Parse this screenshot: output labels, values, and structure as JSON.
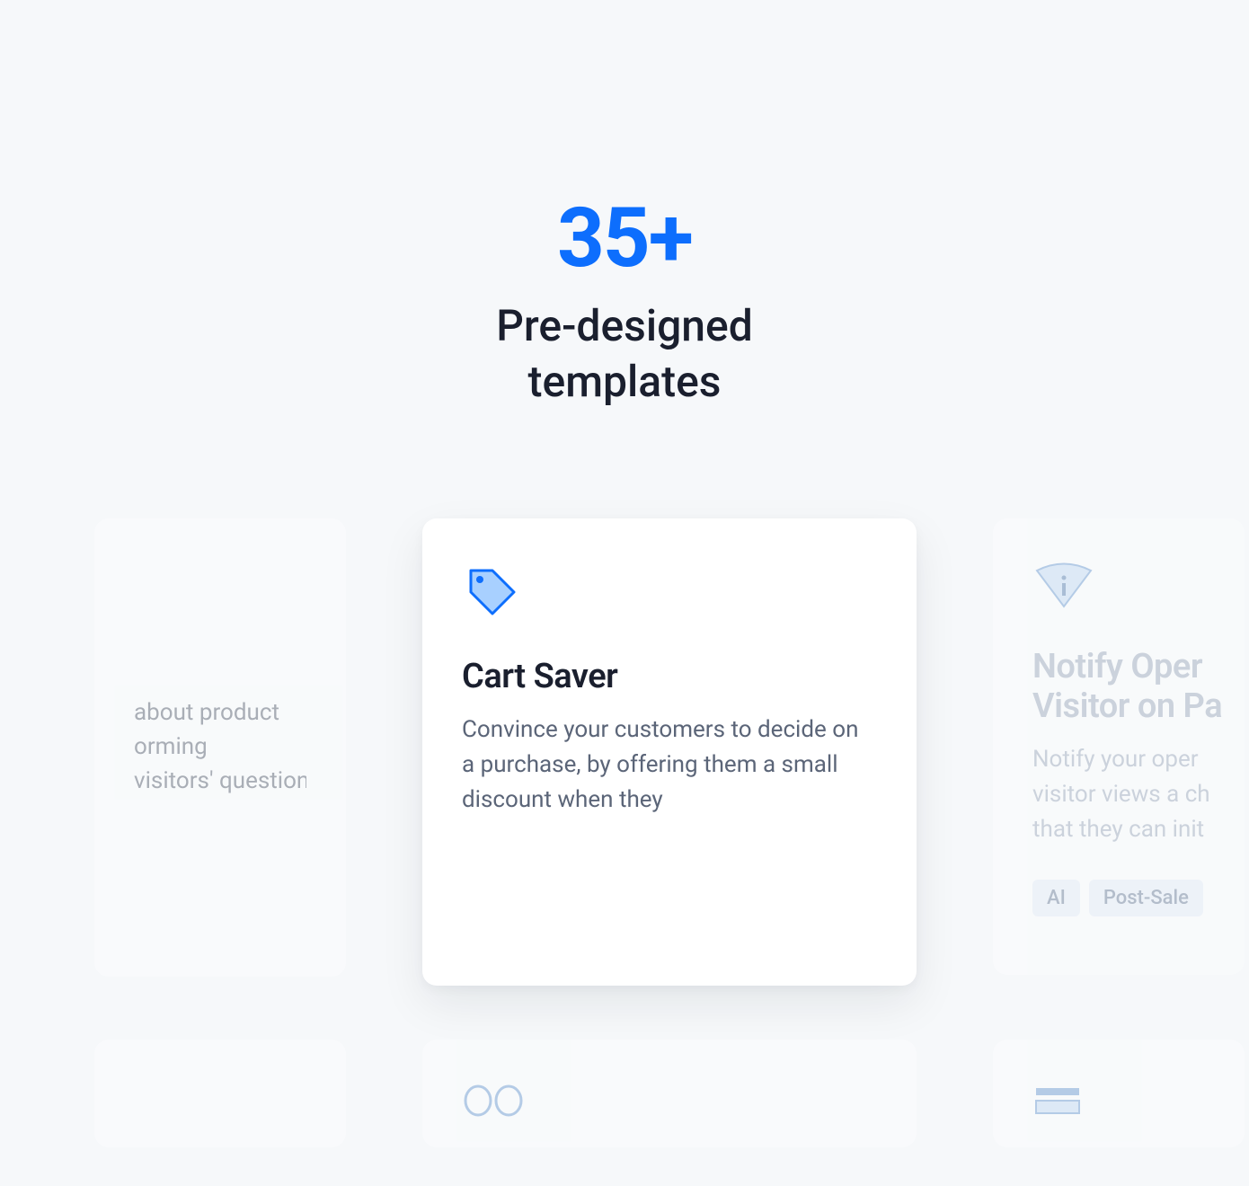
{
  "header": {
    "count": "35+",
    "subtitle_line1": "Pre-designed",
    "subtitle_line2": "templates"
  },
  "cards": {
    "left": {
      "desc_line1": "about product",
      "desc_line2": "orming",
      "desc_line3": "visitors' questions"
    },
    "center": {
      "title": "Cart Saver",
      "desc": "Convince your customers to decide on a purchase, by offering them a small discount when they"
    },
    "right": {
      "title_line1": "Notify Oper",
      "title_line2": "Visitor on Pa",
      "desc_line1": "Notify your oper",
      "desc_line2": "visitor views a ch",
      "desc_line3": "that they can init",
      "badges": [
        "AI",
        "Post-Sale"
      ]
    }
  },
  "icons": {
    "tag": "tag-icon",
    "wifi": "wifi-info-icon",
    "eyes": "eyes-icon",
    "card": "card-icon"
  }
}
